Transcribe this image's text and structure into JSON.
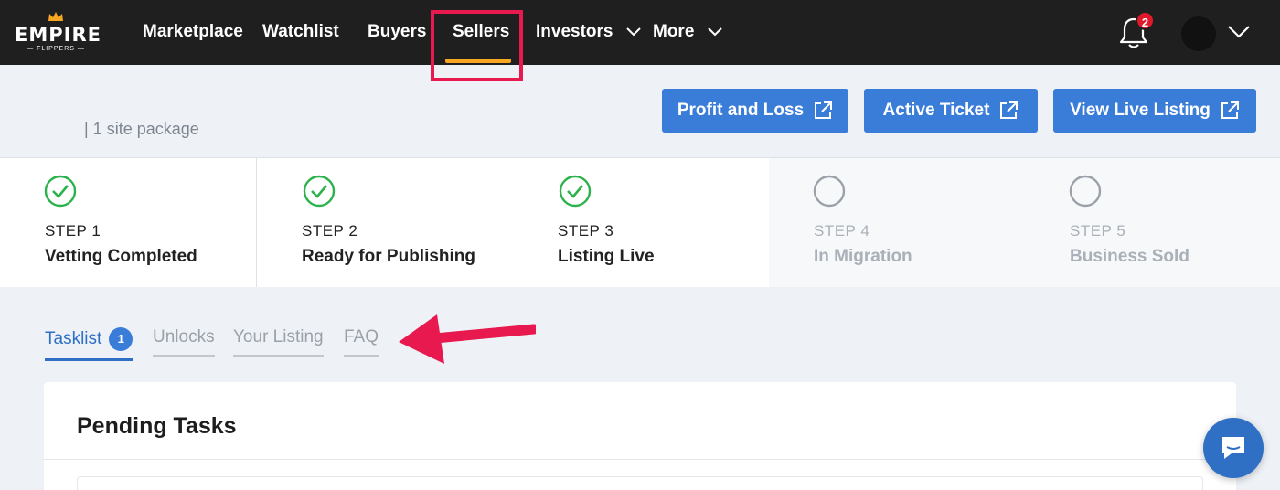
{
  "nav": {
    "logo_text": "EMPIRE",
    "logo_sub": "— FLIPPERS —",
    "items": [
      {
        "label": "Marketplace"
      },
      {
        "label": "Watchlist"
      },
      {
        "label": "Buyers"
      },
      {
        "label": "Sellers",
        "active": true
      },
      {
        "label": "Investors",
        "dropdown": true
      },
      {
        "label": "More",
        "dropdown": true
      }
    ],
    "notification_count": "2",
    "active_color": "#f6a623",
    "highlight_color": "#e8194e"
  },
  "header": {
    "subtitle": "| 1 site package",
    "buttons": [
      {
        "label": "Profit and Loss",
        "icon": "external-link-icon"
      },
      {
        "label": "Active Ticket",
        "icon": "external-link-icon"
      },
      {
        "label": "View Live Listing",
        "icon": "external-link-icon"
      }
    ],
    "button_color": "#3a7dd8"
  },
  "steps": [
    {
      "number": "STEP 1",
      "title": "Vetting Completed",
      "status": "done"
    },
    {
      "number": "STEP 2",
      "title": "Ready for Publishing",
      "status": "done"
    },
    {
      "number": "STEP 3",
      "title": "Listing Live",
      "status": "done"
    },
    {
      "number": "STEP 4",
      "title": "In Migration",
      "status": "pending"
    },
    {
      "number": "STEP 5",
      "title": "Business Sold",
      "status": "pending"
    }
  ],
  "tabs": [
    {
      "label": "Tasklist",
      "badge": "1",
      "active": true
    },
    {
      "label": "Unlocks"
    },
    {
      "label": "Your Listing"
    },
    {
      "label": "FAQ"
    }
  ],
  "panel": {
    "title": "Pending Tasks"
  },
  "colors": {
    "done": "#2bb24c",
    "pending": "#9aa1a9",
    "annotation_arrow": "#e8194e"
  }
}
